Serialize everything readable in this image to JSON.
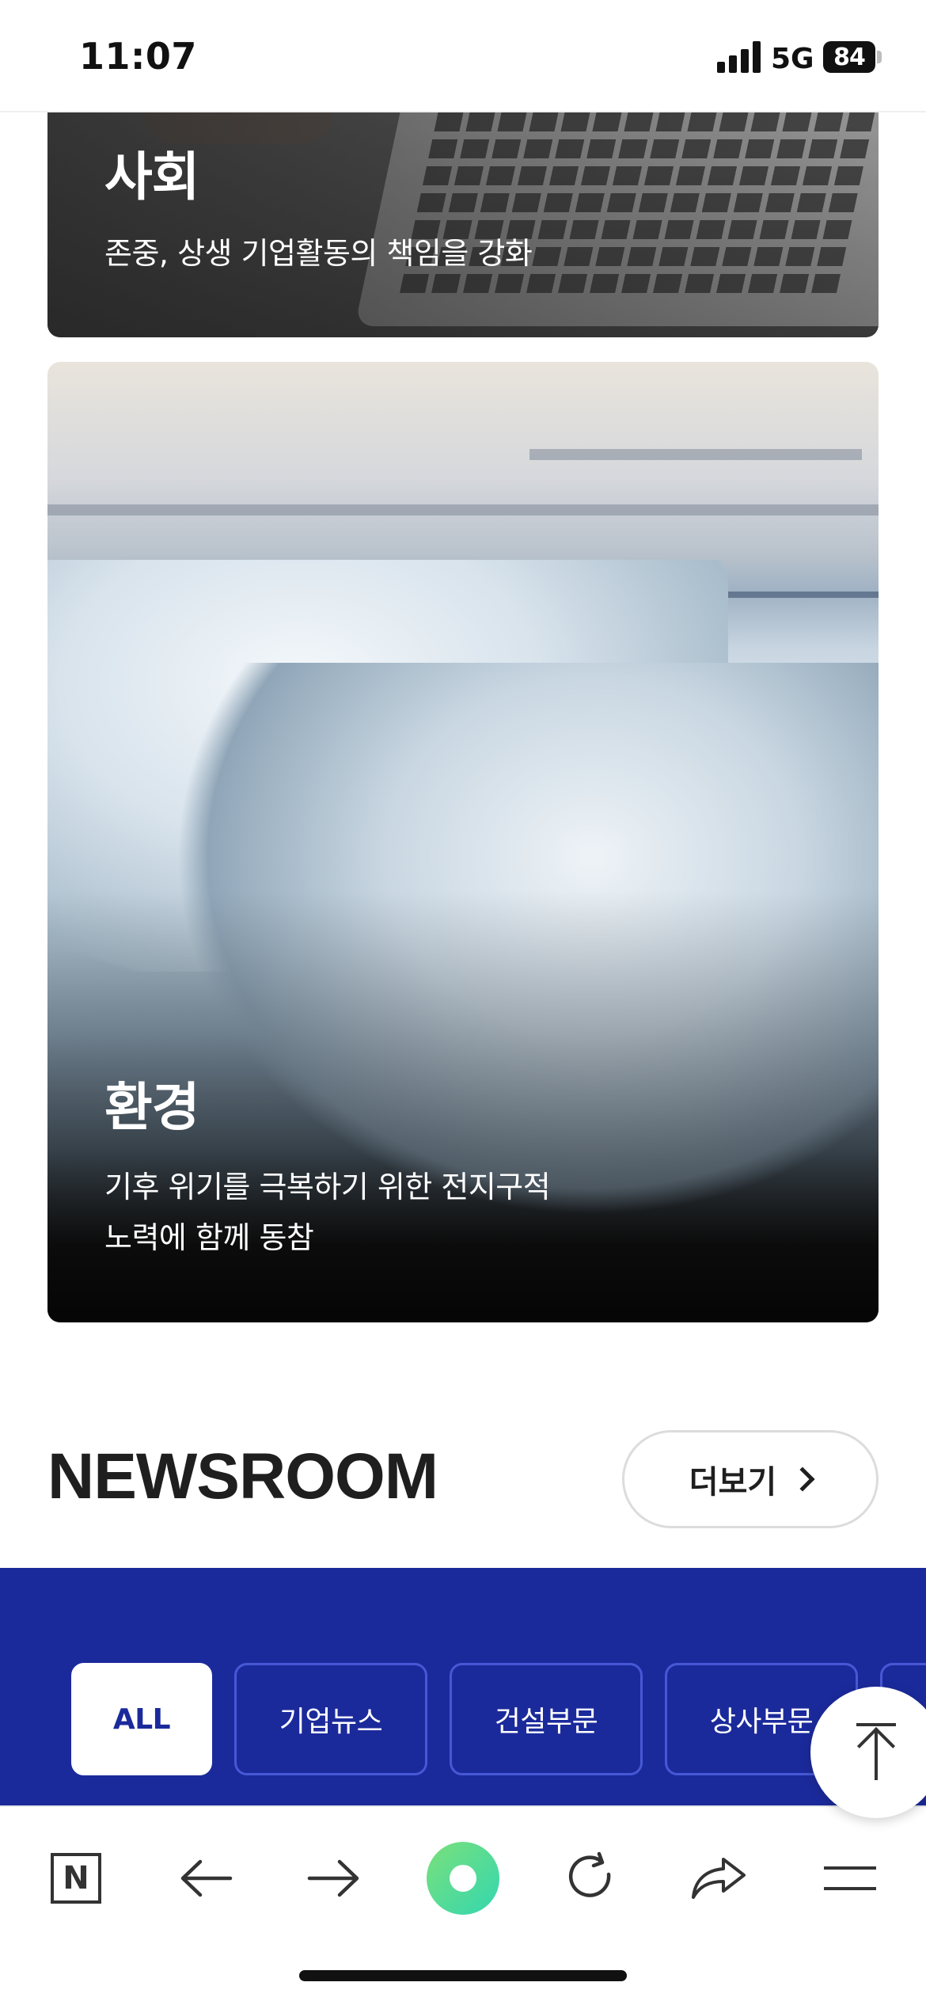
{
  "status_bar": {
    "time": "11:07",
    "network": "5G",
    "battery": "84"
  },
  "cards": {
    "social": {
      "title": "사회",
      "description": "존중, 상생 기업활동의 책임을 강화"
    },
    "environment": {
      "title": "환경",
      "description_line1": "기후 위기를 극복하기 위한 전지구적",
      "description_line2": "노력에 함께 동참"
    }
  },
  "newsroom": {
    "title": "NEWSROOM",
    "more_label": "더보기"
  },
  "tabs": [
    {
      "label": "ALL",
      "active": true
    },
    {
      "label": "기업뉴스",
      "active": false
    },
    {
      "label": "건설부문",
      "active": false
    },
    {
      "label": "상사부문",
      "active": false
    }
  ],
  "colors": {
    "tabs_band": "#1b2a9b",
    "home_button_gradient": [
      "#7be07a",
      "#33d7b0"
    ]
  },
  "browser_bar": {
    "icons": [
      "naver-n-icon",
      "back-arrow-icon",
      "forward-arrow-icon",
      "home-circle-icon",
      "refresh-icon",
      "share-icon",
      "menu-icon"
    ]
  }
}
